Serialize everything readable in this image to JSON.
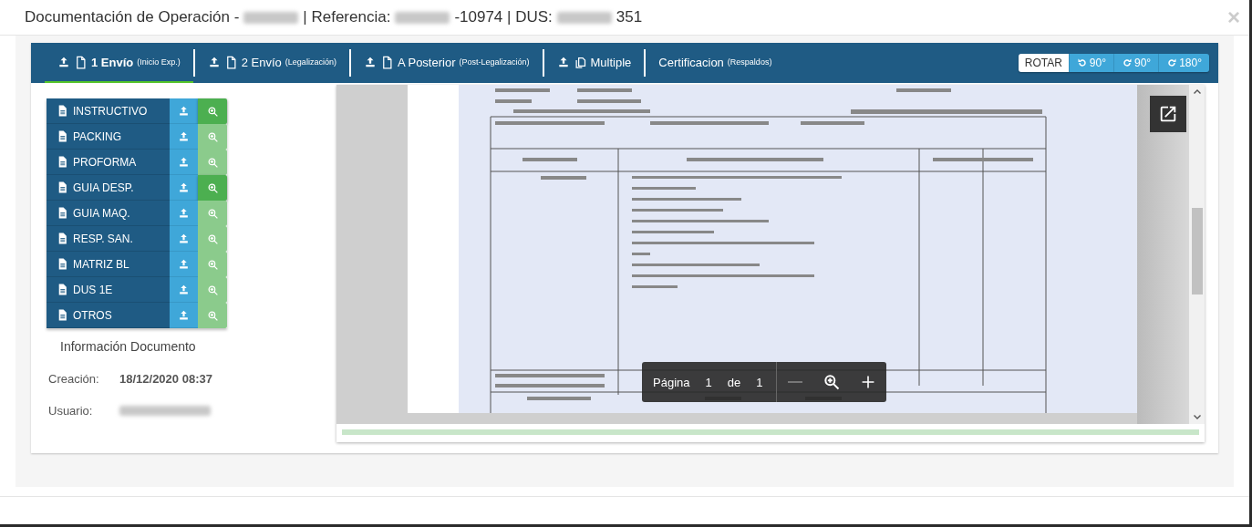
{
  "window": {
    "title_parts": [
      {
        "kind": "text",
        "text": "Documentación de Operación -"
      },
      {
        "kind": "redacted"
      },
      {
        "kind": "text",
        "text": "| Referencia:"
      },
      {
        "kind": "redacted"
      },
      {
        "kind": "text",
        "text": "-10974 | DUS:"
      },
      {
        "kind": "redacted"
      },
      {
        "kind": "text",
        "text": "351"
      }
    ],
    "close": "×"
  },
  "tabs": [
    {
      "label": "1 Envío",
      "sub": "(Inicio Exp.)",
      "kind": "single",
      "selected": true
    },
    {
      "label": "2 Envío",
      "sub": "(Legalización)",
      "kind": "single",
      "selected": false
    },
    {
      "label": "A Posterior",
      "sub": "(Post-Legalización)",
      "kind": "single",
      "selected": false
    },
    {
      "label": "Multiple",
      "kind": "multi",
      "selected": false
    },
    {
      "label": "Certificacion",
      "sub": "(Respaldos)",
      "kind": "plain",
      "selected": false
    }
  ],
  "rotate": {
    "label": "ROTAR",
    "buttons": [
      {
        "kind": "ccw",
        "label": "90°"
      },
      {
        "kind": "cw",
        "label": "90°"
      },
      {
        "kind": "cw",
        "label": "180°"
      }
    ]
  },
  "documents": [
    {
      "label": "INSTRUCTIVO",
      "available": true
    },
    {
      "label": "PACKING",
      "available": false
    },
    {
      "label": "PROFORMA",
      "available": false
    },
    {
      "label": "GUIA DESP.",
      "available": true
    },
    {
      "label": "GUIA MAQ.",
      "available": false
    },
    {
      "label": "RESP. SAN.",
      "available": false
    },
    {
      "label": "MATRIZ BL",
      "available": false
    },
    {
      "label": "DUS 1E",
      "available": false
    },
    {
      "label": "OTROS",
      "available": false
    }
  ],
  "info": {
    "title": "Información Documento",
    "fields": [
      {
        "label": "Creación:",
        "kind": "text",
        "value": "18/12/2020 08:37"
      },
      {
        "label": "Usuario:",
        "kind": "redacted"
      }
    ]
  },
  "viewer": {
    "page_label": "Página",
    "page": "1",
    "of_label": "de",
    "pages": "1",
    "zoom_out_disabled": true,
    "level": 1
  }
}
